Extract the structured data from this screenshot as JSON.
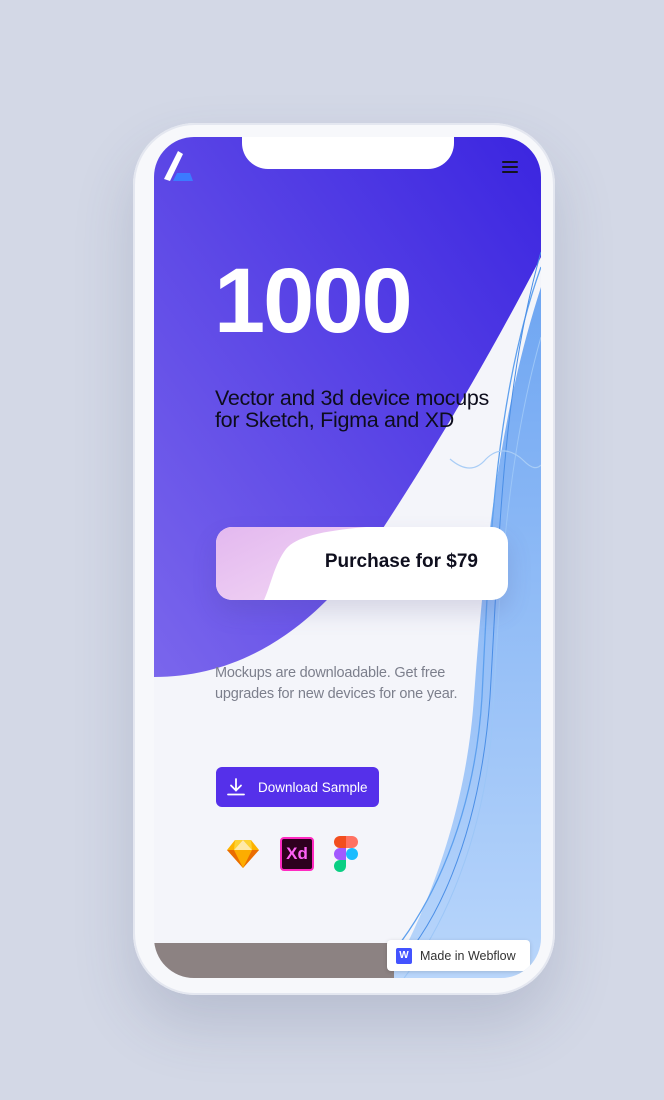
{
  "hero": {
    "number": "1000",
    "subtitle": "Vector and 3d device mocups for Sketch, Figma and XD"
  },
  "purchase": {
    "label": "Purchase for $79"
  },
  "description": "Mockups are downloadable. Get free upgrades for new devices for one year.",
  "download": {
    "label": "Download Sample",
    "icon": "download-icon"
  },
  "tools": [
    {
      "name": "sketch-icon"
    },
    {
      "name": "xd-icon",
      "text": "Xd"
    },
    {
      "name": "figma-icon"
    }
  ],
  "badge": {
    "label": "Made in Webflow",
    "mark": "W"
  },
  "colors": {
    "accent": "#5530ea",
    "hero_dark": "#3b25e0",
    "hero_light": "#7a66ec",
    "blue_sweep": "#7fb0f4",
    "page_bg": "#d3d8e6"
  }
}
